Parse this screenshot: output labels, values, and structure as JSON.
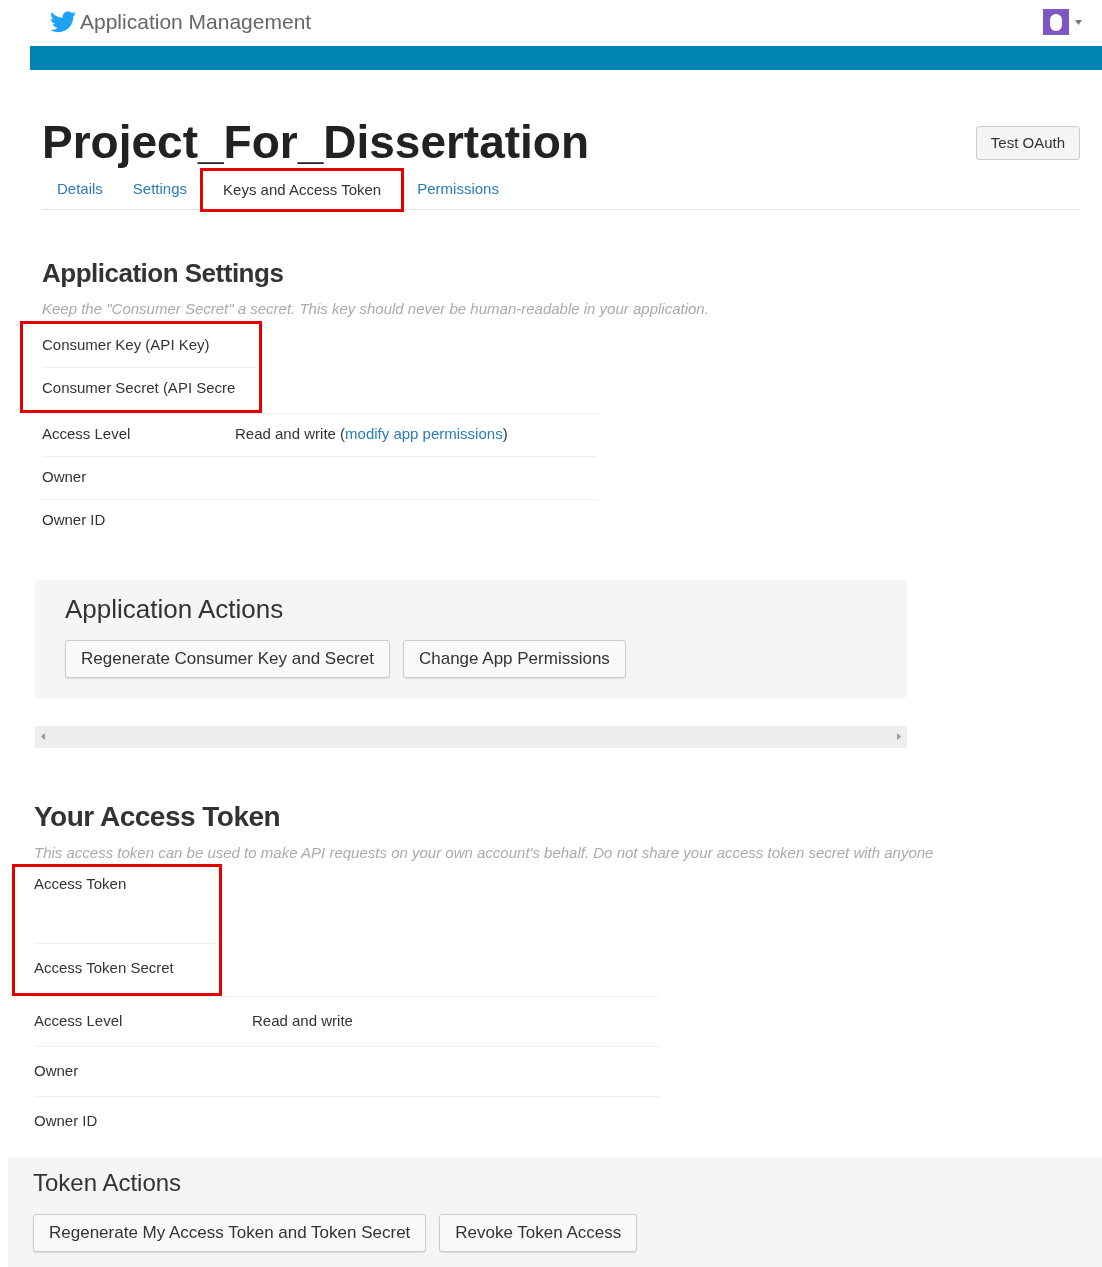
{
  "header": {
    "title": "Application Management"
  },
  "app": {
    "name": "Project_For_Dissertation",
    "test_button": "Test OAuth"
  },
  "tabs": [
    {
      "label": "Details",
      "selected": false,
      "highlighted": false
    },
    {
      "label": "Settings",
      "selected": false,
      "highlighted": false
    },
    {
      "label": "Keys and Access Token",
      "selected": true,
      "highlighted": true
    },
    {
      "label": "Permissions",
      "selected": false,
      "highlighted": false
    }
  ],
  "application_settings": {
    "heading": "Application Settings",
    "note": "Keep the \"Consumer Secret\" a secret. This key should never be human-readable in your application.",
    "rows": [
      {
        "label": "Consumer Key (API Key)",
        "highlighted": true
      },
      {
        "label": "Consumer Secret (API Secre",
        "highlighted": true
      },
      {
        "label": "Access Level",
        "value": "Read and write (",
        "link": "modify app permissions",
        "value_end": ")",
        "highlighted": false
      },
      {
        "label": "Owner",
        "highlighted": false
      },
      {
        "label": "Owner ID",
        "highlighted": false
      }
    ]
  },
  "application_actions": {
    "heading": "Application Actions",
    "buttons": [
      "Regenerate Consumer Key and Secret",
      "Change App Permissions"
    ]
  },
  "access_token": {
    "heading": "Your Access Token",
    "note": "This access token can be used to make API requests on your own account's behalf. Do not share your access token secret with anyone",
    "rows": [
      {
        "label": "Access Token",
        "highlighted": true
      },
      {
        "label": "Access Token Secret",
        "highlighted": true
      },
      {
        "label": "Access Level",
        "value": "Read and write",
        "highlighted": false
      },
      {
        "label": "Owner",
        "highlighted": false
      },
      {
        "label": "Owner ID",
        "highlighted": false
      }
    ]
  },
  "token_actions": {
    "heading": "Token Actions",
    "buttons": [
      "Regenerate My Access Token and Token Secret",
      "Revoke Token Access"
    ]
  }
}
